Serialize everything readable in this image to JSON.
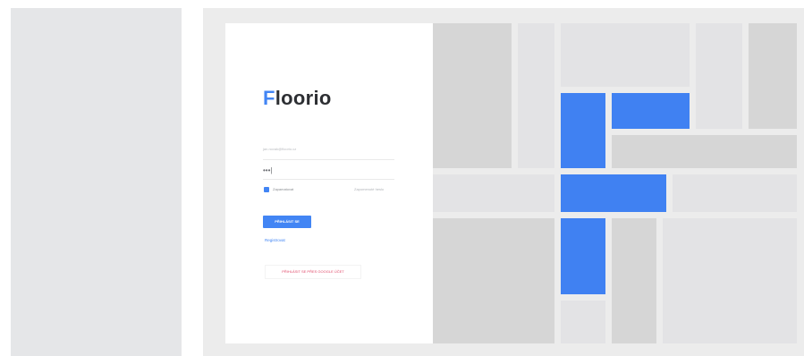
{
  "brand": {
    "logo_first": "F",
    "logo_rest": "loorio",
    "accent_color": "#4285f4"
  },
  "login": {
    "email_placeholder": "jan.novak@floorio.cz",
    "password_value": "•••|",
    "remember_label": "Zapamatovat",
    "forgot_label": "Zapomenuté heslo",
    "submit_label": "PŘIHLÁSIT SE",
    "register_label": "Registrovat",
    "google_label": "PŘIHLÁSIT SE PŘES GOOGLE ÚČET"
  }
}
